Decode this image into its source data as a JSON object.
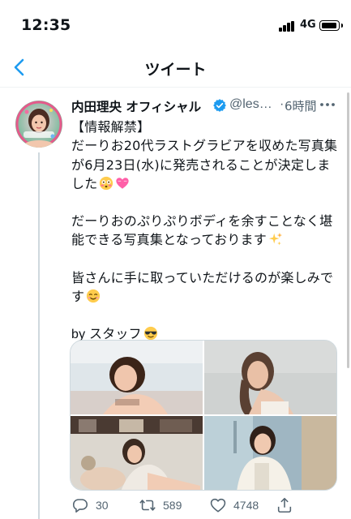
{
  "status_bar": {
    "time": "12:35",
    "network": "4G"
  },
  "header": {
    "title": "ツイート",
    "back_icon": "chevron-left-icon"
  },
  "tweet": {
    "display_name": "内田理央 オフィシャル",
    "handle": "@les…",
    "separator": "·",
    "time": "6時間",
    "body": {
      "line1": "【情報解禁】",
      "line2": "だーりお20代ラストグラビアを収めた写真集が6月23日(水)に発売されることが決定しました",
      "line3": "だーりおのぷりぷりボディを余すことなく堪能できる写真集となっております",
      "line4": "皆さんに手に取っていただけるのが楽しみです",
      "line5": "by スタッフ"
    },
    "media_count": 4,
    "stats": {
      "replies": "30",
      "retweets": "589",
      "likes": "4748"
    }
  },
  "colors": {
    "text": "#0f1419",
    "muted": "#536471",
    "verified": "#1d9bf0",
    "divider": "#eff3f4",
    "thread": "#cfd9de"
  },
  "icons": [
    "chevron-left-icon",
    "verified-badge-icon",
    "more-icon",
    "flushed-emoji-icon",
    "heart-emoji-icon",
    "sparkles-emoji-icon",
    "smile-emoji-icon",
    "sunglasses-emoji-icon",
    "reply-icon",
    "retweet-icon",
    "like-icon",
    "share-icon"
  ]
}
